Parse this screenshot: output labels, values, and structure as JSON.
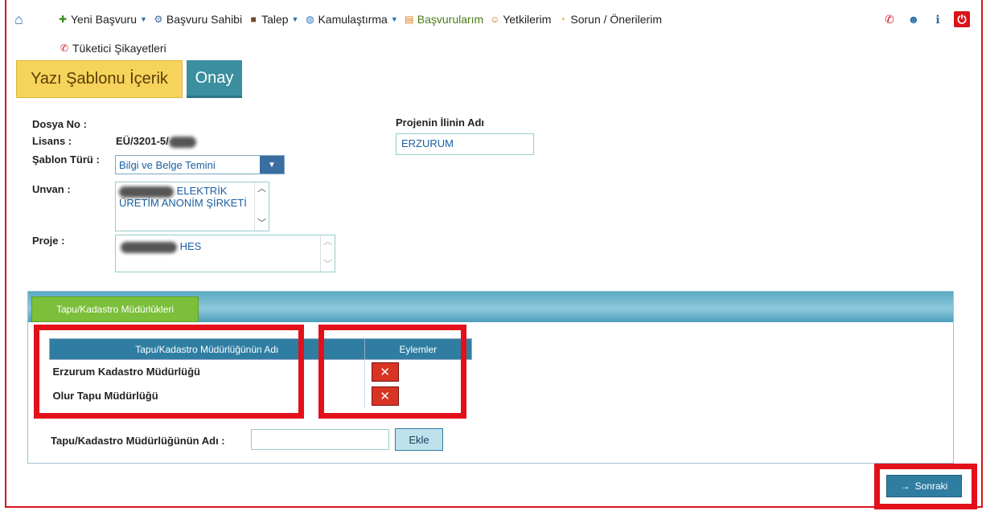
{
  "menu": {
    "items": [
      {
        "label": "Yeni Başvuru",
        "icon": "new-application-icon",
        "dropdown": true
      },
      {
        "label": "Başvuru Sahibi",
        "icon": "applicant-icon",
        "dropdown": false
      },
      {
        "label": "Talep",
        "icon": "request-icon",
        "dropdown": true
      },
      {
        "label": "Kamulaştırma",
        "icon": "globe-icon",
        "dropdown": true
      },
      {
        "label": "Başvurularım",
        "icon": "my-applications-icon",
        "dropdown": false
      },
      {
        "label": "Yetkilerim",
        "icon": "permissions-icon",
        "dropdown": false
      },
      {
        "label": "Sorun / Önerilerim",
        "icon": "feedback-icon",
        "dropdown": false
      }
    ],
    "row2_label": "Tüketici Şikayetleri",
    "caret": "▼"
  },
  "tabs": {
    "template": "Yazı Şablonu İçerik",
    "approval": "Onay"
  },
  "form": {
    "dosya_no_label": "Dosya No :",
    "lisans_label": "Lisans :",
    "lisans_value": "EÜ/3201-5/",
    "sablon_label": "Şablon Türü :",
    "sablon_value": "Bilgi ve Belge Temini",
    "unvan_label": "Unvan :",
    "unvan_value": "ELEKTRİK ÜRETİM ANONİM ŞİRKETİ",
    "proje_label": "Proje :",
    "proje_value": "HES",
    "il_label": "Projenin İlinin Adı",
    "il_value": "ERZURUM"
  },
  "panel": {
    "tab_label": "Tapu/Kadastro Müdürlükleri",
    "columns": [
      "Tapu/Kadastro Müdürlüğünün Adı",
      "Eylemler"
    ],
    "rows": [
      {
        "name": "Erzurum Kadastro Müdürlüğü"
      },
      {
        "name": "Olur Tapu Müdürlüğü"
      }
    ],
    "delete_glyph": "✕",
    "add_label": "Tapu/Kadastro Müdürlüğünün Adı :",
    "add_value": "",
    "add_button": "Ekle"
  },
  "footer": {
    "next_button": "Sonraki",
    "next_arrow": "→"
  },
  "colors": {
    "highlight": "#e3101a",
    "accent": "#2f7ea2",
    "tab_green": "#7bbf3a",
    "tab_yellow": "#f6d45c"
  }
}
